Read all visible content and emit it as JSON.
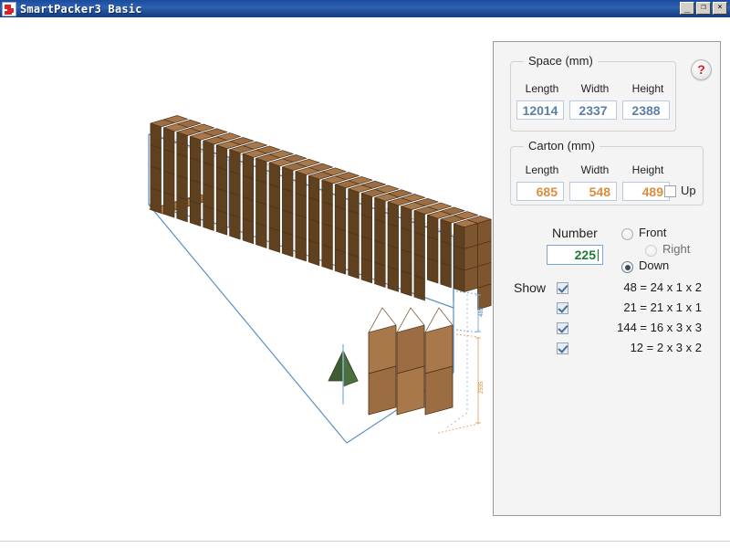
{
  "window": {
    "title": "SmartPacker3 Basic",
    "icon": "app-icon",
    "minimize_label": "_",
    "restore_label": "❐",
    "close_label": "×"
  },
  "panel": {
    "help_label": "?",
    "space": {
      "title": "Space (mm)",
      "headers": [
        "Length",
        "Width",
        "Height"
      ],
      "values": [
        "12014",
        "2337",
        "2388"
      ],
      "color": "#5b7fa6"
    },
    "carton": {
      "title": "Carton (mm)",
      "headers": [
        "Length",
        "Width",
        "Height"
      ],
      "values": [
        "685",
        "548",
        "489"
      ],
      "color": "#d98e3a",
      "up_label": "Up",
      "up_checked": false
    },
    "number": {
      "label": "Number",
      "value": "225",
      "color": "#1d7a36"
    },
    "orientation": {
      "options": [
        {
          "label": "Front",
          "selected": false,
          "dim": false
        },
        {
          "label": "Right",
          "selected": false,
          "dim": true
        },
        {
          "label": "Down",
          "selected": true,
          "dim": false
        }
      ]
    },
    "show": {
      "label": "Show",
      "rows": [
        {
          "text": "48 = 24 x 1 x 2",
          "checked": true
        },
        {
          "text": "21 = 21 x 1 x 1",
          "checked": true
        },
        {
          "text": "144 = 16 x 3 x 3",
          "checked": true
        },
        {
          "text": "12 = 2 x 3 x 2",
          "checked": true
        }
      ]
    }
  },
  "viewport": {
    "container_color": "#5b8fc0",
    "carton_top_color": "#a9784a",
    "carton_side_color": "#6e4a27",
    "marker_color": "#3d5c32",
    "dimension_labels": [
      {
        "text": "489",
        "color": "#4a7db5"
      },
      {
        "text": "2535",
        "color": "#d98e3a"
      }
    ]
  }
}
